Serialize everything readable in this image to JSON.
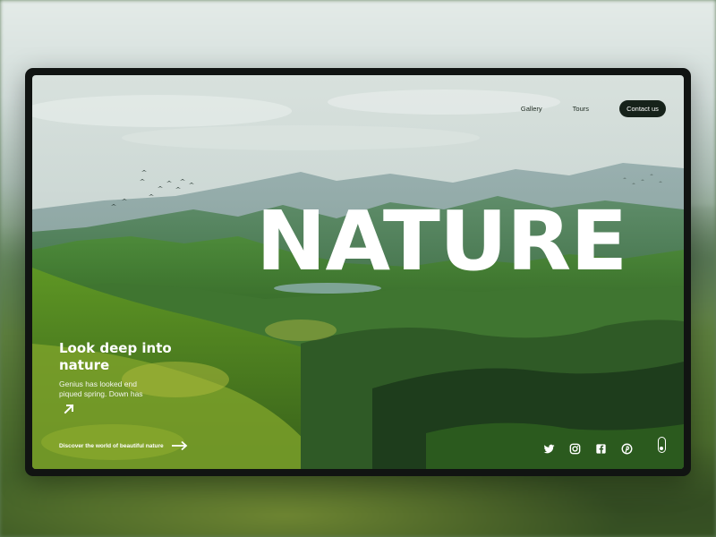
{
  "nav": {
    "links": [
      "Gallery",
      "Tours"
    ],
    "contact_label": "Contact us"
  },
  "hero": {
    "big_word": "NATURE",
    "title": "Look deep into nature",
    "subtitle": "Genius has looked end piqued spring. Down has",
    "cta_label": "Discover the world of beautiful nature"
  },
  "icons": {
    "hero_arrow": "arrow-up-right-icon",
    "cta_arrow": "arrow-right-icon",
    "social": [
      "twitter-icon",
      "instagram-icon",
      "facebook-icon",
      "pinterest-icon"
    ],
    "scroll": "scroll-mouse-icon"
  },
  "colors": {
    "accent_dark": "#16221a",
    "text_light": "#ffffff",
    "frame": "#111412"
  }
}
